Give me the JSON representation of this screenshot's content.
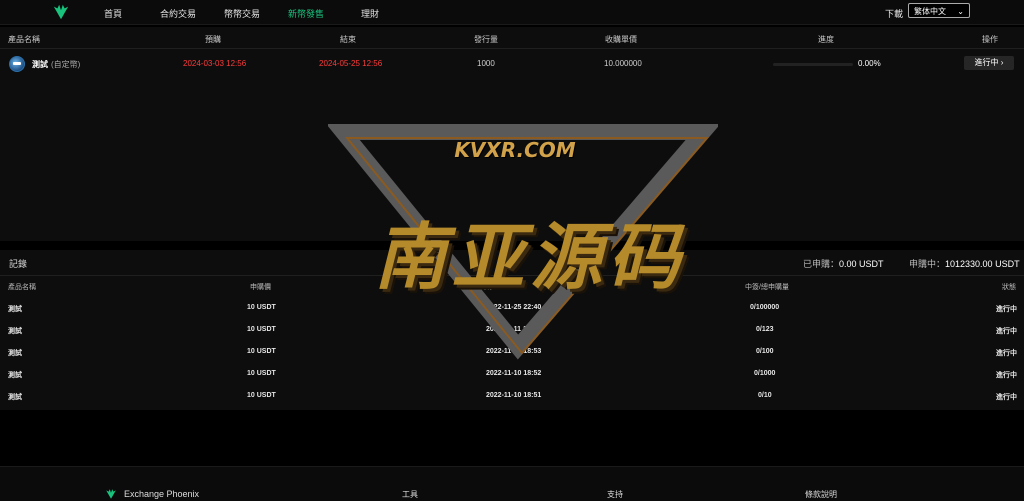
{
  "nav": {
    "items": [
      {
        "label": "首頁",
        "active": false
      },
      {
        "label": "合約交易",
        "active": false
      },
      {
        "label": "幣幣交易",
        "active": false
      },
      {
        "label": "新幣發售",
        "active": true
      },
      {
        "label": "理財",
        "active": false
      }
    ],
    "download": "下載",
    "language": "繁体中文"
  },
  "offerings": {
    "headers": [
      "產品名稱",
      "預購",
      "結束",
      "發行量",
      "收購單價",
      "進度",
      "操作"
    ],
    "rows": [
      {
        "name": "測試",
        "tag": "(自定幣)",
        "start": "2024-03-03 12:56",
        "end": "2024-05-25 12:56",
        "supply": "1000",
        "price": "10.000000",
        "progress": "0.00%",
        "progress_fraction": 0,
        "action": "進行中"
      }
    ]
  },
  "records": {
    "title": "記錄",
    "subscribed_label": "已申購：",
    "subscribed_value": "0.00 USDT",
    "applying_label": "申購中：",
    "applying_value": "1012330.00 USDT",
    "headers": [
      "產品名稱",
      "申購價",
      "預期",
      "中簽/總申購量",
      "狀態"
    ],
    "rows": [
      {
        "name": "測試",
        "price": "10 USDT",
        "time": "2022-11-25 22:40",
        "ratio": "0/100000",
        "status": "進行中"
      },
      {
        "name": "測試",
        "price": "10 USDT",
        "time": "2022-11-11 15:20",
        "ratio": "0/123",
        "status": "進行中"
      },
      {
        "name": "測試",
        "price": "10 USDT",
        "time": "2022-11-10 18:53",
        "ratio": "0/100",
        "status": "進行中"
      },
      {
        "name": "測試",
        "price": "10 USDT",
        "time": "2022-11-10 18:52",
        "ratio": "0/1000",
        "status": "進行中"
      },
      {
        "name": "測試",
        "price": "10 USDT",
        "time": "2022-11-10 18:51",
        "ratio": "0/10",
        "status": "進行中"
      }
    ]
  },
  "footer": {
    "brand": "Exchange Phoenix",
    "cols": [
      "工具",
      "支持",
      "條款說明"
    ]
  },
  "watermark": {
    "site": "KVXR.COM",
    "text": "南亚源码"
  },
  "colors": {
    "accent": "#19c37d",
    "danger": "#ff3b3b",
    "gold": "#b58a2a"
  },
  "icons": {
    "logo": "phoenix-logo-icon",
    "coin": "coin-icon",
    "chevron": "chevron-down-icon"
  }
}
